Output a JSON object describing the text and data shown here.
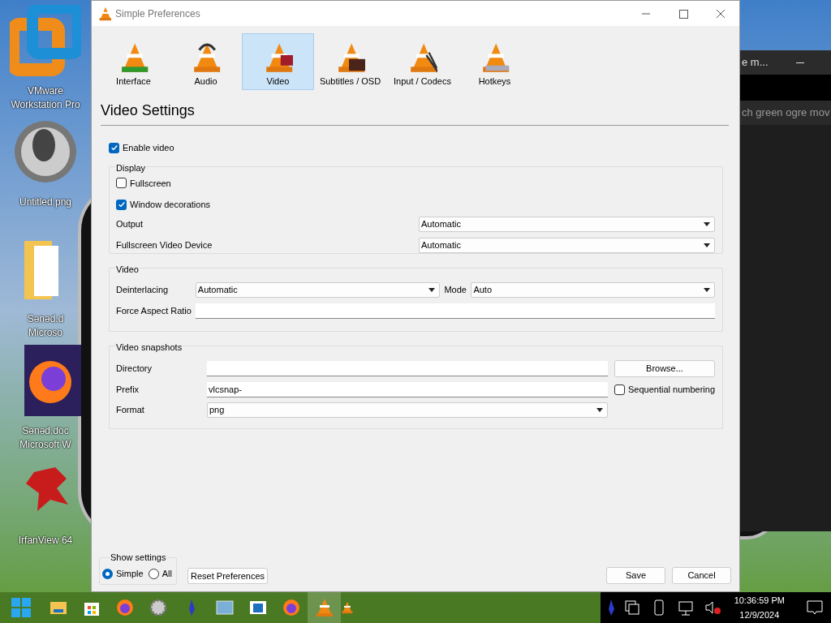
{
  "desktop_icons": [
    {
      "kind": "vmware",
      "lines": [
        "VMware",
        "Workstation Pro"
      ]
    },
    {
      "kind": "ball",
      "lines": [
        "Untitled.png"
      ]
    },
    {
      "kind": "folder",
      "lines": [
        "Sənəd.d",
        "Microso"
      ]
    },
    {
      "kind": "firefox",
      "lines": [
        "Sənəd.doc",
        "Microsoft W"
      ]
    },
    {
      "kind": "irfan",
      "lines": [
        "IrfanView 64"
      ]
    }
  ],
  "background_window": {
    "title": "e m...",
    "text": "ch green ogre mov"
  },
  "window": {
    "title": "Simple Preferences"
  },
  "categories": [
    {
      "label": "Interface",
      "kind": "interface",
      "selected": false
    },
    {
      "label": "Audio",
      "kind": "audio",
      "selected": false
    },
    {
      "label": "Video",
      "kind": "video",
      "selected": true
    },
    {
      "label": "Subtitles / OSD",
      "kind": "subtitles",
      "selected": false
    },
    {
      "label": "Input / Codecs",
      "kind": "input",
      "selected": false
    },
    {
      "label": "Hotkeys",
      "kind": "hotkeys",
      "selected": false
    }
  ],
  "heading": "Video Settings",
  "enable_video": {
    "label": "Enable video",
    "checked": true
  },
  "display": {
    "title": "Display",
    "checkboxes": [
      {
        "label": "Fullscreen",
        "checked": false
      },
      {
        "label": "Window decorations",
        "checked": true
      }
    ],
    "selects": [
      {
        "label": "Output",
        "value": "Automatic"
      },
      {
        "label": "Fullscreen Video Device",
        "value": "Automatic"
      }
    ]
  },
  "video": {
    "title": "Video",
    "deinterlacing": {
      "label": "Deinterlacing",
      "value": "Automatic"
    },
    "mode": {
      "label": "Mode",
      "value": "Auto"
    },
    "aspect": {
      "label": "Force Aspect Ratio"
    }
  },
  "snapshots": {
    "title": "Video snapshots",
    "directory": {
      "label": "Directory"
    },
    "browse": "Browse...",
    "prefix": {
      "label": "Prefix",
      "value": "vlcsnap-"
    },
    "sequential": {
      "label": "Sequential numbering",
      "checked": false
    },
    "format": {
      "label": "Format",
      "value": "png"
    }
  },
  "show_settings": {
    "title": "Show settings",
    "options": [
      {
        "label": "Simple",
        "selected": true
      },
      {
        "label": "All",
        "selected": false
      }
    ]
  },
  "buttons": {
    "reset": "Reset Preferences",
    "save": "Save",
    "cancel": "Cancel"
  },
  "taskbar": {
    "apps": [
      {
        "kind": "explorer",
        "active": false
      },
      {
        "kind": "store",
        "active": false
      },
      {
        "kind": "firefox",
        "active": false
      },
      {
        "kind": "gear",
        "active": false
      },
      {
        "kind": "figure",
        "active": false
      },
      {
        "kind": "picture",
        "active": false
      },
      {
        "kind": "window",
        "active": false
      },
      {
        "kind": "firefox",
        "active": false
      },
      {
        "kind": "cone",
        "active": true
      }
    ],
    "time": "10:36:59 PM",
    "date": "12/9/2024"
  }
}
